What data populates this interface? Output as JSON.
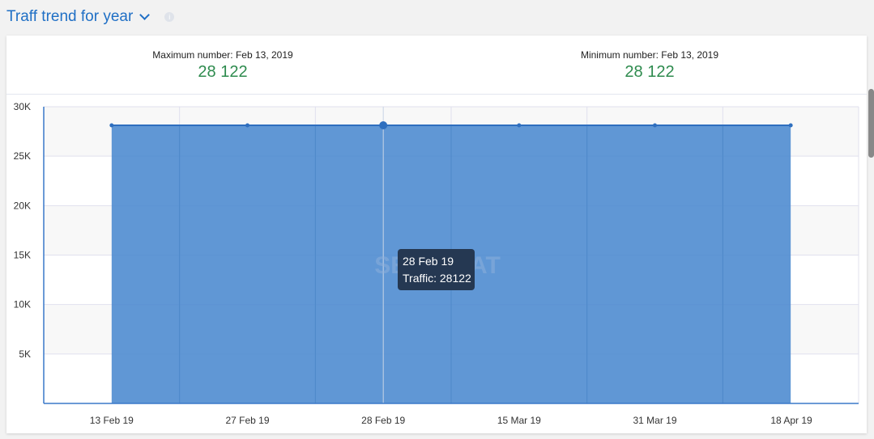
{
  "header": {
    "title": "Traff trend for year"
  },
  "stats": {
    "max_label": "Maximum number: Feb 13, 2019",
    "max_value": "28 122",
    "min_label": "Minimum number: Feb 13, 2019",
    "min_value": "28 122"
  },
  "tooltip": {
    "date": "28 Feb 19",
    "text": "Traffic: 28122"
  },
  "watermark": "SERPSTAT",
  "colors": {
    "fill": "#4a89cf",
    "line": "#2f6fbf",
    "value": "#2e8b4e",
    "title": "#1f6fc5"
  },
  "chart_data": {
    "type": "area",
    "categories": [
      "13 Feb 19",
      "27 Feb 19",
      "28 Feb 19",
      "15 Mar 19",
      "31 Mar 19",
      "18 Apr 19"
    ],
    "values": [
      28122,
      28122,
      28122,
      28122,
      28122,
      28122
    ],
    "yticks": [
      "5K",
      "10K",
      "15K",
      "20K",
      "25K",
      "30K"
    ],
    "ylim": [
      0,
      30000
    ],
    "grid": true,
    "highlighted_index": 2
  }
}
